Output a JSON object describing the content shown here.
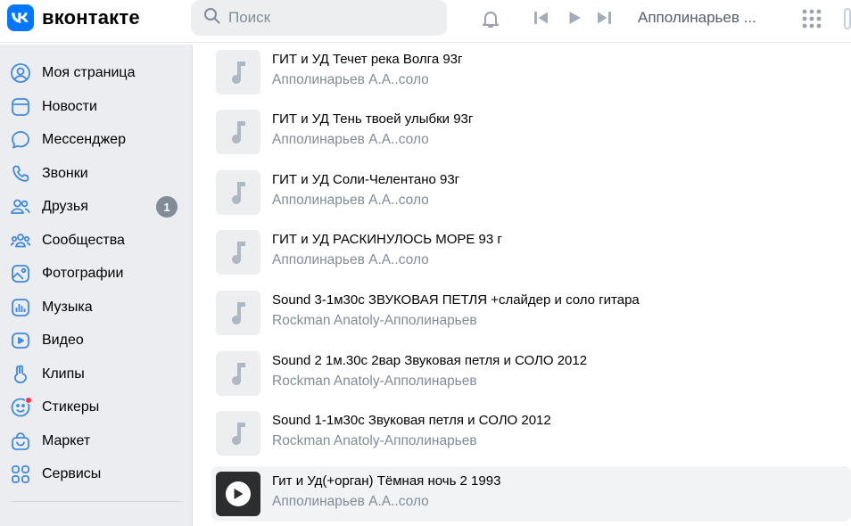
{
  "header": {
    "logo_text": "вконтакте",
    "search_placeholder": "Поиск",
    "now_playing": "Апполинарьев ..."
  },
  "sidebar": {
    "items": [
      {
        "label": "Моя страница",
        "icon": "user-circle-icon"
      },
      {
        "label": "Новости",
        "icon": "newsfeed-icon"
      },
      {
        "label": "Мессенджер",
        "icon": "message-icon"
      },
      {
        "label": "Звонки",
        "icon": "phone-icon"
      },
      {
        "label": "Друзья",
        "icon": "friends-icon",
        "badge": "1"
      },
      {
        "label": "Сообщества",
        "icon": "communities-icon"
      },
      {
        "label": "Фотографии",
        "icon": "photo-icon"
      },
      {
        "label": "Музыка",
        "icon": "music-icon"
      },
      {
        "label": "Видео",
        "icon": "video-icon"
      },
      {
        "label": "Клипы",
        "icon": "clips-icon"
      },
      {
        "label": "Стикеры",
        "icon": "sticker-icon"
      },
      {
        "label": "Маркет",
        "icon": "market-icon"
      },
      {
        "label": "Сервисы",
        "icon": "services-icon"
      }
    ]
  },
  "tracks": [
    {
      "title": "ГИТ и УД Течет река Волга 93г",
      "artist": "Апполинарьев А.А..соло"
    },
    {
      "title": "ГИТ и УД Тень твоей улыбки 93г",
      "artist": "Апполинарьев А.А..соло"
    },
    {
      "title": "ГИТ и УД Соли-Челентано 93г",
      "artist": "Апполинарьев А.А..соло"
    },
    {
      "title": "ГИТ и УД РАСКИНУЛОСЬ МОРЕ 93 г",
      "artist": "Апполинарьев А.А..соло"
    },
    {
      "title": "Sound 3-1м30с ЗВУКОВАЯ ПЕТЛЯ +слайдер и соло гитара",
      "artist": "Rockman Anatoly-Апполинарьев"
    },
    {
      "title": "Sound 2 1м.30с 2вар Звуковая петля и СОЛО 2012",
      "artist": "Rockman Anatoly-Апполинарьев"
    },
    {
      "title": "Sound 1-1м30с Звуковая петля и СОЛО 2012",
      "artist": "Rockman Anatoly-Апполинарьев"
    },
    {
      "title": "Гит и Уд(+орган) Тёмная ночь 2 1993",
      "artist": "Апполинарьев А.А..соло",
      "active": true
    }
  ],
  "colors": {
    "brand": "#0077ff",
    "icon": "#3f8ae0",
    "sidebar_bg": "#ebedf0",
    "secondary_text": "#818c99",
    "badge": "#818c99",
    "notification_dot": "#ff3347"
  }
}
